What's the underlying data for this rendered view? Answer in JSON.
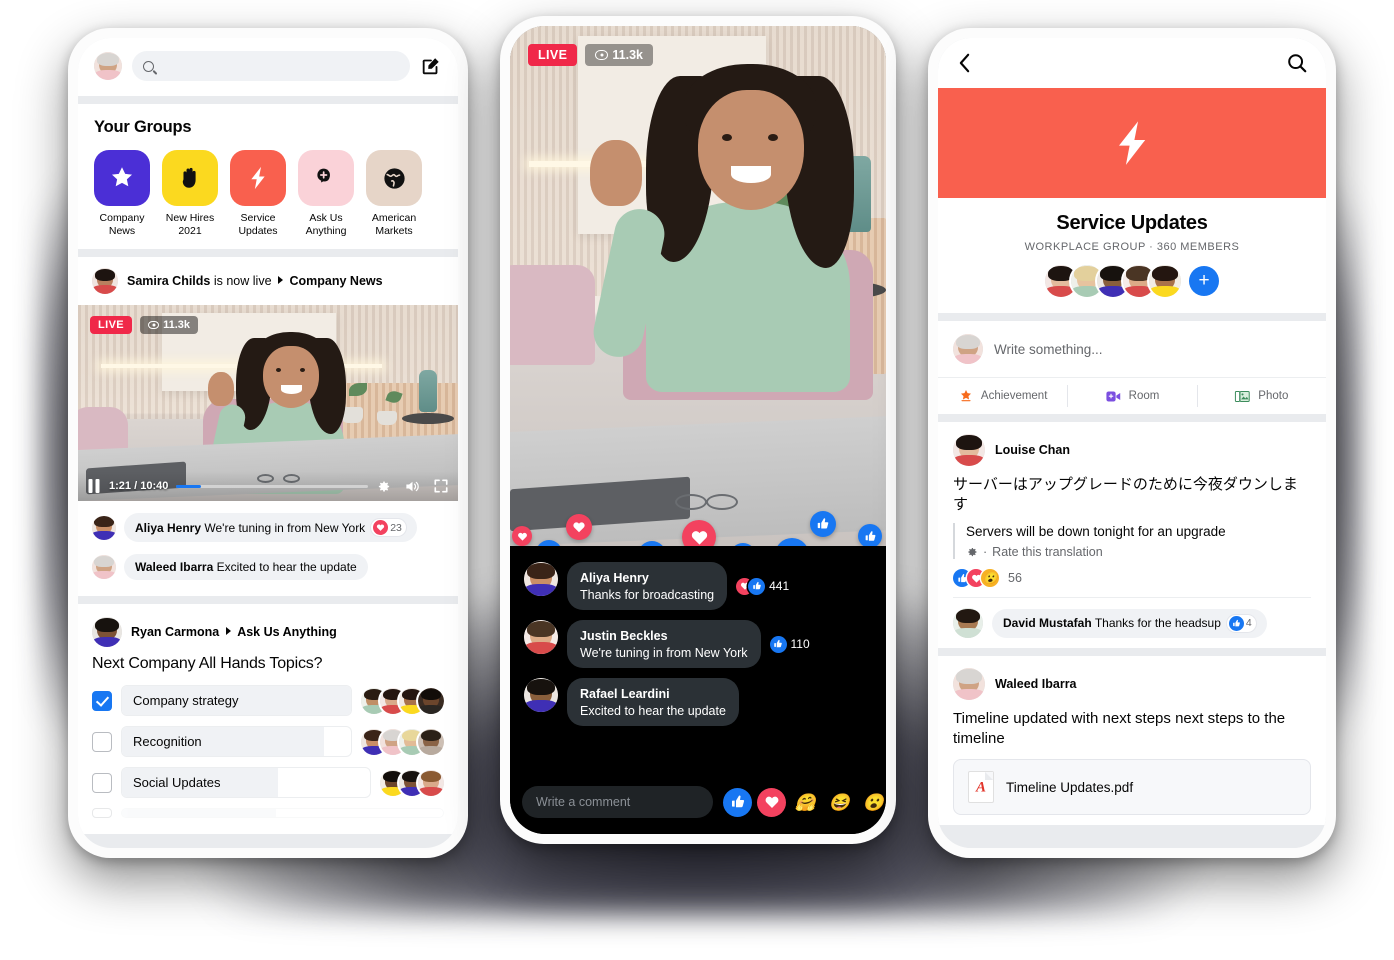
{
  "colors": {
    "brand_blue": "#1877f2",
    "live_red": "#f02849",
    "love_red": "#f3425f",
    "wow_yellow": "#f7b125",
    "group_company_news": "#4b2fd6",
    "group_new_hires": "#fbd91f",
    "group_service_updates": "#f9604e",
    "group_ask_us": "#fad2d8",
    "group_american_markets": "#e6d5c8",
    "surface": "#ffffff",
    "page_bg": "#e9ebee"
  },
  "phone_left": {
    "topbar": {
      "avatar_name": "user-avatar",
      "search_placeholder": "",
      "compose_icon": "compose-icon"
    },
    "groups_section": {
      "title": "Your Groups",
      "items": [
        {
          "label": "Company News",
          "icon": "star-icon",
          "color": "#4b2fd6",
          "glyph_color": "#ffffff"
        },
        {
          "label": "New Hires 2021",
          "icon": "waving-hand-icon",
          "color": "#fbd91f",
          "glyph_color": "#111111"
        },
        {
          "label": "Service Updates",
          "icon": "lightning-bolt-icon",
          "color": "#f9604e",
          "glyph_color": "#ffffff"
        },
        {
          "label": "Ask Us Anything",
          "icon": "question-chat-icon",
          "color": "#fad2d8",
          "glyph_color": "#111111"
        },
        {
          "label": "American Markets",
          "icon": "globe-icon",
          "color": "#e6d5c8",
          "glyph_color": "#111111"
        }
      ]
    },
    "live_post": {
      "author": "Samira Childs",
      "status": "is now live",
      "group": "Company News",
      "live_badge": "LIVE",
      "viewers": "11.3k",
      "player": {
        "current_time": "1:21",
        "duration": "10:40",
        "separator": "/",
        "progress_percent": 13,
        "pause_icon": "pause-icon",
        "settings_icon": "gear-icon",
        "volume_icon": "volume-icon",
        "fullscreen_icon": "fullscreen-icon"
      },
      "comments": [
        {
          "author": "Aliya Henry",
          "text": "We're tuning in from New York",
          "reaction": "love",
          "count": "23"
        },
        {
          "author": "Waleed Ibarra",
          "text": "Excited to hear the update",
          "reaction": null,
          "count": null
        }
      ]
    },
    "poll_post": {
      "author": "Ryan Carmona",
      "group": "Ask Us Anything",
      "question": "Next Company All Hands Topics?",
      "options": [
        {
          "label": "Company strategy",
          "checked": true,
          "fill_percent": 100,
          "voters": 4
        },
        {
          "label": "Recognition",
          "checked": false,
          "fill_percent": 88,
          "voters": 4
        },
        {
          "label": "Social Updates",
          "checked": false,
          "fill_percent": 63,
          "voters": 3
        }
      ]
    }
  },
  "phone_center": {
    "live_badge": "LIVE",
    "viewers": "11.3k",
    "comments": [
      {
        "author": "Aliya Henry",
        "text": "Thanks for broadcasting",
        "reactions": [
          "love",
          "like"
        ],
        "count": "441"
      },
      {
        "author": "Justin Beckles",
        "text": "We're tuning in from New York",
        "reactions": [
          "like"
        ],
        "count": "110"
      },
      {
        "author": "Rafael Leardini",
        "text": "Excited to hear the update",
        "reactions": [],
        "count": null
      }
    ],
    "composer_placeholder": "Write a comment",
    "reaction_bar": [
      {
        "name": "like-reaction",
        "glyph": "👍"
      },
      {
        "name": "love-reaction",
        "glyph": "❤"
      },
      {
        "name": "care-reaction",
        "glyph": "🤗"
      },
      {
        "name": "haha-reaction",
        "glyph": "😆"
      },
      {
        "name": "wow-reaction",
        "glyph": "😮"
      }
    ]
  },
  "phone_right": {
    "nav": {
      "back_icon": "back-chevron-icon",
      "search_icon": "search-icon"
    },
    "group": {
      "cover_icon": "lightning-bolt-icon",
      "cover_color": "#f9604e",
      "name": "Service Updates",
      "subtitle": "WORKPLACE GROUP ·  360 MEMBERS",
      "member_avatars": 5,
      "add_member_label": "+"
    },
    "composer": {
      "placeholder": "Write something...",
      "actions": [
        {
          "label": "Achievement",
          "icon": "achievement-star-icon"
        },
        {
          "label": "Room",
          "icon": "room-video-icon"
        },
        {
          "label": "Photo",
          "icon": "photo-icon"
        }
      ]
    },
    "posts": [
      {
        "author": "Louise Chan",
        "body": "サーバーはアップグレードのために今夜ダウンします",
        "translation": "Servers will be down tonight for an upgrade",
        "rate_translation": "Rate this translation",
        "rate_separator": "·",
        "reactions": [
          "like",
          "love",
          "wow"
        ],
        "reaction_count": "56",
        "comment": {
          "author": "David Mustafah",
          "text": "Thanks for the headsup",
          "reaction": "like",
          "count": "4"
        }
      },
      {
        "author": "Waleed Ibarra",
        "body": "Timeline updated with next steps next steps to the timeline",
        "attachment": {
          "name": "Timeline Updates.pdf",
          "icon": "pdf-file-icon"
        }
      }
    ]
  }
}
